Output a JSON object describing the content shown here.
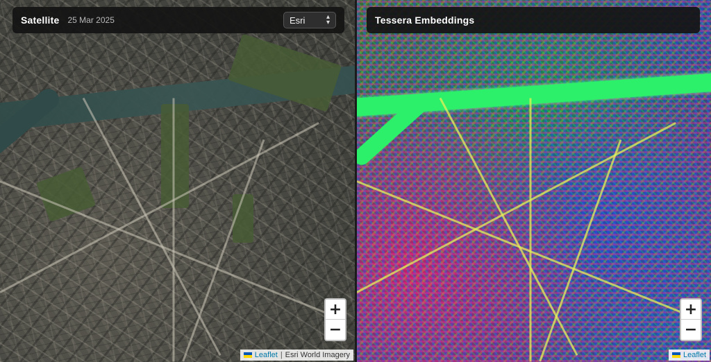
{
  "left_panel": {
    "title": "Satellite",
    "date": "25 Mar 2025",
    "layer_select": {
      "selected": "Esri"
    },
    "zoom_in_label": "+",
    "zoom_out_label": "−",
    "attribution": {
      "link": "Leaflet",
      "separator": "|",
      "source": "Esri World Imagery"
    }
  },
  "right_panel": {
    "title": "Tessera Embeddings",
    "zoom_in_label": "+",
    "zoom_out_label": "−",
    "attribution": {
      "link": "Leaflet"
    }
  },
  "colors": {
    "panel_bg": "#141414",
    "river_embedding": "#2cf06a",
    "attribution_link": "#0078a8"
  },
  "icons": {
    "select_chevron": "chevron-updown-icon",
    "flag": "ukraine-flag-icon"
  }
}
